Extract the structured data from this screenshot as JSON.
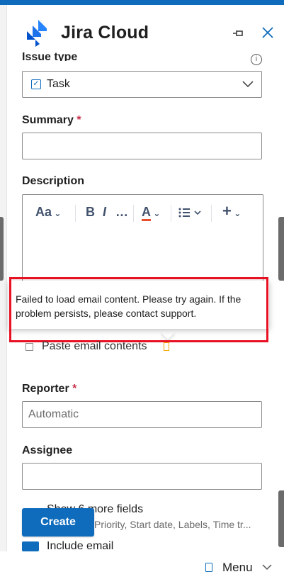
{
  "header": {
    "title": "Jira Cloud",
    "pin_icon": "pin-icon",
    "close_icon": "close-icon",
    "brand_color": "#2684ff"
  },
  "issue_type": {
    "label": "Issue type",
    "value": "Task"
  },
  "summary": {
    "label": "Summary",
    "required_mark": "*",
    "value": ""
  },
  "description": {
    "label": "Description",
    "toolbar": {
      "text_style": "Aa",
      "bold": "B",
      "italic": "I",
      "more": "…",
      "color": "A",
      "plus": "+"
    }
  },
  "tooltip": {
    "message": "Failed to load email content. Please try again. If the problem persists, please contact support."
  },
  "paste": {
    "label": "Paste email contents"
  },
  "reporter": {
    "label": "Reporter",
    "required_mark": "*",
    "placeholder": "Automatic"
  },
  "assignee": {
    "label": "Assignee",
    "value": ""
  },
  "more_fields": {
    "title": "Show 6 more fields",
    "subtitle": "Priority, Start date, Labels, Time tr..."
  },
  "create_button": {
    "label": "Create"
  },
  "include": {
    "label": "Include email"
  },
  "footer": {
    "menu_label": "Menu"
  },
  "colors": {
    "accent": "#0f6cbd",
    "required": "#c4314b",
    "error_outline": "#e81123"
  }
}
